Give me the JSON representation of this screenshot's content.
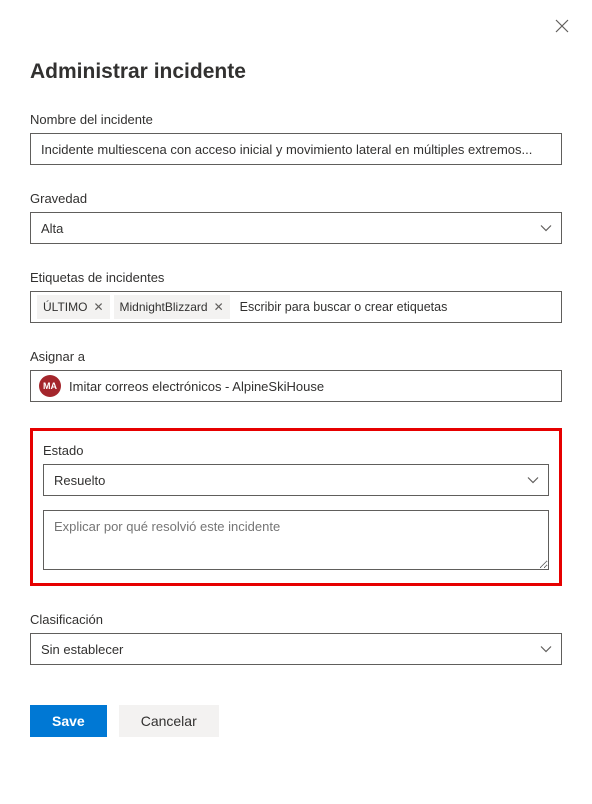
{
  "header": {
    "title": "Administrar incidente"
  },
  "fields": {
    "incident_name": {
      "label": "Nombre del incidente",
      "value": "Incidente multiescena con acceso inicial y movimiento lateral en múltiples extremos..."
    },
    "severity": {
      "label": "Gravedad",
      "value": "Alta"
    },
    "tags": {
      "label": "Etiquetas de incidentes",
      "items": [
        "ÚLTIMO",
        "MidnightBlizzard"
      ],
      "placeholder": "Escribir para buscar o crear etiquetas"
    },
    "assign": {
      "label": "Asignar a",
      "avatar_initials": "MA",
      "value": "Imitar correos electrónicos - AlpineSkiHouse"
    },
    "status": {
      "label": "Estado",
      "value": "Resuelto"
    },
    "status_reason": {
      "placeholder": "Explicar por qué resolvió este incidente"
    },
    "classification": {
      "label": "Clasificación",
      "value": "Sin establecer"
    }
  },
  "buttons": {
    "save": "Save",
    "cancel": "Cancelar"
  }
}
